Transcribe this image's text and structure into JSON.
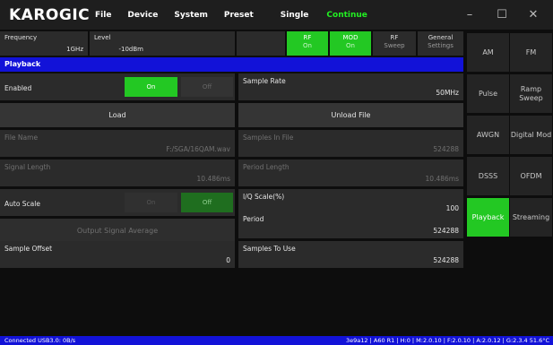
{
  "app": {
    "logo": "KAROGIC"
  },
  "menu": {
    "file": "File",
    "device": "Device",
    "system": "System",
    "preset": "Preset",
    "single": "Single",
    "continue": "Continue"
  },
  "window": {
    "minimize": "–",
    "maximize": "☐",
    "close": "✕"
  },
  "params": {
    "frequency": {
      "label": "Frequency",
      "value": "1GHz"
    },
    "level": {
      "label": "Level",
      "value": "-10dBm"
    }
  },
  "toggles": {
    "rf": {
      "label": "RF",
      "state": "On"
    },
    "mod": {
      "label": "MOD",
      "state": "On"
    },
    "rf_sweep": {
      "line1": "RF",
      "line2": "Sweep"
    },
    "general_settings": {
      "line1": "General",
      "line2": "Settings"
    }
  },
  "section": {
    "title": "Playback"
  },
  "sidebar": {
    "items": [
      {
        "label": "AM"
      },
      {
        "label": "FM"
      },
      {
        "label": "Pulse"
      },
      {
        "label": "Ramp Sweep"
      },
      {
        "label": "AWGN"
      },
      {
        "label": "Digital Mod"
      },
      {
        "label": "DSSS"
      },
      {
        "label": "OFDM"
      },
      {
        "label": "Playback"
      },
      {
        "label": "Streaming"
      }
    ],
    "active": "Playback"
  },
  "playback": {
    "enabled": {
      "label": "Enabled",
      "on": "On",
      "off": "Off"
    },
    "sample_rate": {
      "label": "Sample Rate",
      "value": "50MHz"
    },
    "load": "Load",
    "unload_file": "Unload File",
    "file_name": {
      "label": "File Name",
      "value": "F:/SGA/16QAM.wav"
    },
    "samples_in_file": {
      "label": "Samples In File",
      "value": "524288"
    },
    "signal_length": {
      "label": "Signal Length",
      "value": "10.486ms"
    },
    "period_length": {
      "label": "Period Length",
      "value": "10.486ms"
    },
    "auto_scale": {
      "label": "Auto Scale",
      "on": "On",
      "off": "Off"
    },
    "iq_scale": {
      "label": "I/Q Scale(%)",
      "value": "100"
    },
    "output_signal_average": "Output Signal Average",
    "period": {
      "label": "Period",
      "value": "524288"
    },
    "sample_offset": {
      "label": "Sample Offset",
      "value": "0"
    },
    "samples_to_use": {
      "label": "Samples To Use",
      "value": "524288"
    }
  },
  "status": {
    "left": "Connected USB3.0: 0B/s",
    "right": "3e9a12 | A60 R1 | H:0 | M:2.0.10 | F:2.0.10 | A:2.0.12 | G:2.3.4 51.6°C"
  }
}
